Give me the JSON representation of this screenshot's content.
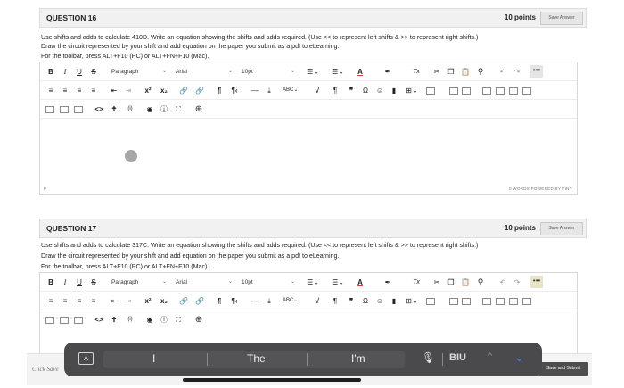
{
  "questions": [
    {
      "title": "QUESTION 16",
      "points": "10 points",
      "save_label": "Save Answer",
      "text": [
        "Use shifts and adds to calculate 410D. Write an equation showing the shifts and adds required. (Use << to represent left shifts & >> to represent right shifts.)",
        "Draw the circuit represented by your shift and add equation on the paper you submit as a pdf to eLearning.",
        "For the toolbar, press ALT+F10 (PC) or ALT+FN+F10 (Mac)."
      ],
      "status_left": "P",
      "status_right": "0 WORDS  POWERED BY TINY"
    },
    {
      "title": "QUESTION 17",
      "points": "10 points",
      "save_label": "Save Answer",
      "text": [
        "Use shifts and adds to calculate 317C. Write an equation showing the shifts and adds required. (Use << to represent left shifts & >> to represent right shifts.)",
        "Draw the circuit represented by your shift and add equation on the paper you submit as a pdf to eLearning.",
        "For the toolbar, press ALT+F10 (PC) or ALT+FN+F10 (Mac)."
      ]
    }
  ],
  "toolbar": {
    "bold": "B",
    "italic": "I",
    "underline": "U",
    "strike": "S",
    "paragraph": "Paragraph",
    "font": "Arial",
    "size": "10pt",
    "text_color": "A",
    "clear_format": "Tx",
    "more": "•••",
    "superscript": "x²",
    "subscript": "x₂",
    "pilcrow": "¶",
    "rtl": "¶‹",
    "hr": "—",
    "quote": "❞",
    "omega": "Ω",
    "code": "<>",
    "upload": "(i)"
  },
  "keyboard": {
    "suggestions": [
      "I",
      "The",
      "I'm"
    ],
    "format_label": "BIU",
    "mic_icon": "microphone-icon",
    "key_icon": "A"
  },
  "footer": {
    "click_save": "Click Save",
    "save_submit": "Save and Submit"
  },
  "colors": {
    "keyboard_bg": "#4a4a4c",
    "accent_blue": "#2e8df5",
    "touch_dot": "#a7a7a7"
  }
}
